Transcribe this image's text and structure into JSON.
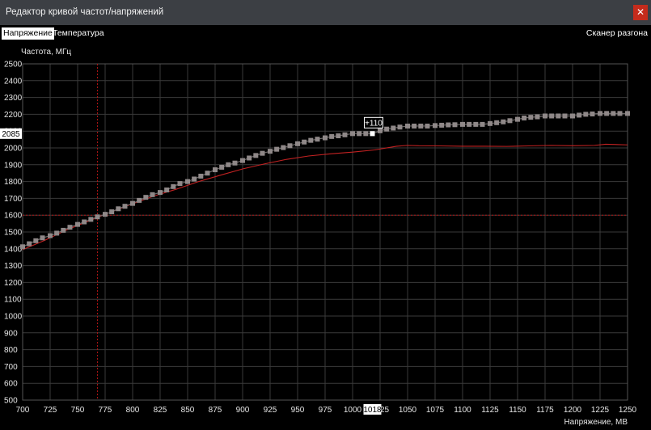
{
  "window": {
    "title": "Редактор кривой частот/напряжений",
    "close_glyph": "✕"
  },
  "tabs": [
    {
      "label": "Напряжение",
      "active": true
    },
    {
      "label": "Температура",
      "active": false
    }
  ],
  "scanner_label": "Сканер разгона",
  "selection": {
    "voltage_label": "1018",
    "freq_label": "2085",
    "offset_label": "+110"
  },
  "colors": {
    "grid": "#3a3a3a",
    "point": "#8f8888",
    "current_curve": "#c32222",
    "crosshair": "#b01515",
    "selected_point": "#ffffff"
  },
  "chart_data": {
    "type": "line",
    "xlabel": "Напряжение, МВ",
    "ylabel": "Частота, МГц",
    "xlim": [
      700,
      1250
    ],
    "ylim": [
      500,
      2500
    ],
    "x_ticks": [
      700,
      725,
      750,
      775,
      800,
      825,
      850,
      875,
      900,
      925,
      950,
      975,
      1000,
      1025,
      1050,
      1075,
      1100,
      1125,
      1150,
      1175,
      1200,
      1225,
      1250
    ],
    "x_tick_labels": [
      "700",
      "725",
      "750",
      "775",
      "800",
      "825",
      "850",
      "875",
      "900",
      "925",
      "950",
      "975",
      "1000",
      "1025",
      "1050",
      "1075",
      "1100",
      "1125",
      "1150",
      "1175",
      "1200",
      "1225",
      "1250"
    ],
    "y_ticks": [
      500,
      600,
      700,
      800,
      900,
      1000,
      1100,
      1200,
      1300,
      1400,
      1500,
      1600,
      1700,
      1800,
      1900,
      2000,
      2100,
      2200,
      2300,
      2400,
      2500
    ],
    "y_tick_labels": [
      "500",
      "600",
      "700",
      "800",
      "900",
      "1000",
      "1100",
      "1200",
      "1300",
      "1400",
      "1500",
      "1600",
      "1700",
      "1800",
      "1900",
      "2000",
      "2100",
      "2200",
      "2300",
      "2400",
      "2500"
    ],
    "grid": true,
    "crosshair": {
      "x": 768,
      "y": 1600
    },
    "selected_point": {
      "x": 1018,
      "y": 2085
    },
    "series": [
      {
        "role": "points",
        "x": [
          700,
          706,
          712,
          718,
          725,
          731,
          737,
          743,
          750,
          756,
          762,
          768,
          775,
          781,
          787,
          793,
          800,
          806,
          812,
          818,
          825,
          831,
          837,
          843,
          850,
          856,
          862,
          868,
          875,
          881,
          887,
          893,
          900,
          906,
          912,
          918,
          925,
          931,
          937,
          943,
          950,
          956,
          962,
          968,
          975,
          981,
          987,
          993,
          1000,
          1006,
          1012,
          1018,
          1025,
          1031,
          1037,
          1043,
          1050,
          1056,
          1062,
          1068,
          1075,
          1081,
          1087,
          1093,
          1100,
          1106,
          1112,
          1118,
          1125,
          1131,
          1137,
          1143,
          1150,
          1156,
          1162,
          1168,
          1175,
          1181,
          1187,
          1193,
          1200,
          1206,
          1212,
          1218,
          1225,
          1231,
          1237,
          1243,
          1250
        ],
        "y": [
          1412,
          1430,
          1448,
          1465,
          1478,
          1493,
          1510,
          1528,
          1545,
          1560,
          1575,
          1590,
          1605,
          1620,
          1638,
          1653,
          1670,
          1688,
          1706,
          1722,
          1735,
          1750,
          1770,
          1788,
          1800,
          1815,
          1832,
          1850,
          1870,
          1885,
          1900,
          1910,
          1925,
          1940,
          1955,
          1968,
          1980,
          1992,
          2002,
          2013,
          2025,
          2035,
          2045,
          2052,
          2060,
          2068,
          2072,
          2078,
          2085,
          2085,
          2085,
          2085,
          2102,
          2112,
          2118,
          2124,
          2130,
          2130,
          2130,
          2130,
          2133,
          2135,
          2137,
          2138,
          2140,
          2140,
          2140,
          2140,
          2145,
          2150,
          2155,
          2162,
          2170,
          2178,
          2182,
          2185,
          2190,
          2190,
          2190,
          2190,
          2190,
          2195,
          2200,
          2202,
          2205,
          2205,
          2205,
          2205,
          2205
        ]
      },
      {
        "role": "current",
        "x": [
          700,
          720,
          740,
          760,
          780,
          800,
          820,
          840,
          860,
          880,
          900,
          920,
          940,
          960,
          980,
          1000,
          1020,
          1040,
          1050,
          1060,
          1080,
          1100,
          1120,
          1140,
          1160,
          1180,
          1200,
          1220,
          1230,
          1250
        ],
        "y": [
          1395,
          1450,
          1512,
          1565,
          1618,
          1668,
          1715,
          1755,
          1800,
          1838,
          1875,
          1905,
          1932,
          1952,
          1965,
          1975,
          1988,
          2010,
          2015,
          2013,
          2012,
          2010,
          2010,
          2009,
          2012,
          2015,
          2013,
          2015,
          2022,
          2018
        ]
      }
    ]
  }
}
